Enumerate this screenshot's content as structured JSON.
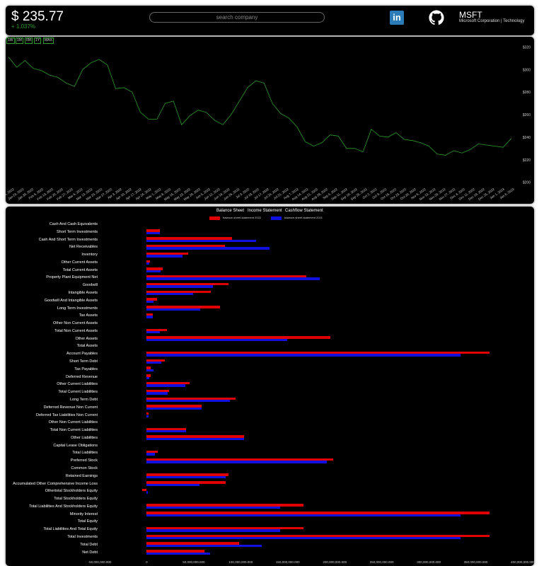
{
  "header": {
    "price": "$ 235.77",
    "change": "+ 1.037%",
    "search_placeholder": "search company",
    "ticker": "MSFT",
    "company": "Microsoft Corporation | Technology",
    "linkedin_icon": "linkedin-icon",
    "github_icon": "github-icon"
  },
  "price_chart": {
    "ranges": [
      "1W",
      "1M",
      "6M",
      "1Y",
      "MAX"
    ],
    "line_color": "#2e9c2e",
    "chart_data": {
      "type": "line",
      "x": [
        "Jan 16, 2022",
        "Jan 23, 2022",
        "Jan 30, 2022",
        "Feb 6, 2022",
        "Feb 13, 2022",
        "Feb 20, 2022",
        "Feb 27, 2022",
        "Mar 6, 2022",
        "Mar 13, 2022",
        "Mar 20, 2022",
        "Mar 27, 2022",
        "Apr 3, 2022",
        "Apr 10, 2022",
        "Apr 17, 2022",
        "Apr 24, 2022",
        "May 1, 2022",
        "May 8, 2022",
        "May 15, 2022",
        "May 22, 2022",
        "May 29, 2022",
        "Jun 5, 2022",
        "Jun 12, 2022",
        "Jun 19, 2022",
        "Jun 26, 2022",
        "Jul 3, 2022",
        "Jul 10, 2022",
        "Jul 17, 2022",
        "Jul 24, 2022",
        "Jul 31, 2022",
        "Aug 7, 2022",
        "Aug 14, 2022",
        "Aug 21, 2022",
        "Aug 28, 2022",
        "Sep 4, 2022",
        "Sep 11, 2022",
        "Sep 18, 2022",
        "Sep 25, 2022",
        "Oct 2, 2022",
        "Oct 9, 2022",
        "Oct 16, 2022",
        "Oct 23, 2022",
        "Oct 30, 2022",
        "Nov 6, 2022",
        "Nov 13, 2022",
        "Nov 20, 2022",
        "Nov 27, 2022",
        "Dec 4, 2022",
        "Dec 11, 2022",
        "Dec 18, 2022",
        "Dec 25, 2022",
        "Jan 1, 2023",
        "Jan 8, 2023"
      ],
      "y": [
        311,
        302,
        308,
        301,
        299,
        295,
        293,
        288,
        285,
        300,
        306,
        309,
        304,
        283,
        284,
        280,
        262,
        256,
        256,
        270,
        272,
        251,
        259,
        264,
        262,
        255,
        251,
        260,
        272,
        284,
        290,
        288,
        270,
        261,
        257,
        249,
        236,
        232,
        235,
        242,
        241,
        230,
        230,
        227,
        247,
        241,
        240,
        244,
        238,
        237,
        235,
        232,
        225,
        224,
        228,
        226,
        229,
        234,
        233,
        232,
        231,
        239
      ],
      "yticks": [
        200,
        220,
        240,
        260,
        280,
        300,
        320
      ],
      "ylim": [
        196,
        324
      ],
      "xlabel": "",
      "ylabel": ""
    }
  },
  "financials": {
    "tabs": [
      "Balance Sheet",
      "Income Statement",
      "Cashflow Statement"
    ],
    "chart_data": {
      "type": "bar",
      "orientation": "horizontal",
      "categories": [
        "Cash And Cash Equivalents",
        "Short Term Investments",
        "Cash And Short Term Investments",
        "Net Receivables",
        "Inventory",
        "Other Current Assets",
        "Total Current Assets",
        "Property Plant Equipment Net",
        "Goodwill",
        "Intangible Assets",
        "Goodwill And Intangible Assets",
        "Long Term Investments",
        "Tax Assets",
        "Other Non Current Assets",
        "Total Non Current Assets",
        "Other Assets",
        "Total Assets",
        "Account Payables",
        "Short Term Debt",
        "Tax Payables",
        "Deferred Revenue",
        "Other Current Liabilities",
        "Total Current Liabilities",
        "Long Term Debt",
        "Deferred Revenue Non Current",
        "Deferred Tax Liabilities Non Current",
        "Other Non Current Liabilities",
        "Total Non Current Liabilities",
        "Other Liabilities",
        "Capital Lease Obligations",
        "Total Liabilities",
        "Preferred Stock",
        "Common Stock",
        "Retained Earnings",
        "Accumulated Other Comprehensive Income Loss",
        "Othertotal Stockholders Equity",
        "Total Stockholders Equity",
        "Total Liabilities And Stockholders Equity",
        "Minority Interest",
        "Total Equity",
        "Total Liabilities And Total Equity",
        "Total Investments",
        "Total Debt",
        "Net Debt"
      ],
      "series": [
        {
          "name": "balance-sheet-statement 2022",
          "color": "#e00000",
          "values": [
            0,
            13900000,
            90800000,
            83300000,
            44300000,
            3500000,
            16700000,
            169700000,
            87000000,
            67900000,
            11300000,
            78300000,
            6300000,
            0,
            21800000,
            195200000,
            0,
            364800000,
            19000000,
            4000000,
            4000000,
            45500000,
            23700000,
            94800000,
            58700000,
            2200000,
            0,
            41600000,
            103600000,
            0,
            11800000,
            198300000,
            0,
            87000000,
            84300000,
            -4700000,
            0,
            166500000,
            364800000,
            0,
            166500000,
            364800000,
            98500000,
            61500000
          ]
        },
        {
          "name": "balance-sheet-statement 2021",
          "color": "#1010e0",
          "values": [
            0,
            13900000,
            116000000,
            130400000,
            37800000,
            2900000,
            14400000,
            184400000,
            70200000,
            49700000,
            7500000,
            57200000,
            6300000,
            0,
            13900000,
            149300000,
            0,
            333800000,
            15700000,
            7200000,
            3000000,
            41200000,
            22300000,
            88500000,
            58700000,
            1700000,
            0,
            41600000,
            103600000,
            0,
            9000000,
            191800000,
            0,
            83900000,
            56400000,
            1400000,
            0,
            141800000,
            333800000,
            0,
            141800000,
            333800000,
            122200000,
            67700000
          ]
        }
      ],
      "xticks": [
        "-50,000,000.000",
        "0",
        "50,000,000.000",
        "100,000,000.000",
        "150,000,000.000",
        "200,000,000.000",
        "250,000,000.000",
        "300,000,000.000",
        "350,000,000.000",
        "400,000,000.000"
      ],
      "xlim": [
        -50000000,
        400000000
      ],
      "legend": "top"
    }
  }
}
